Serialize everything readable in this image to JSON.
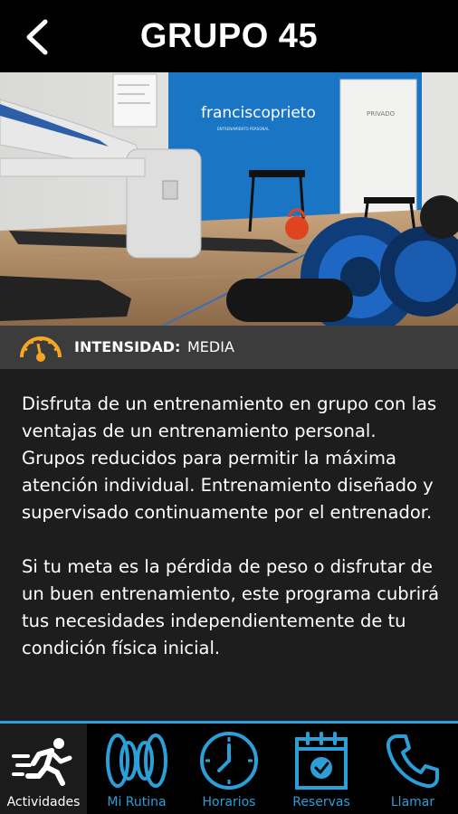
{
  "header": {
    "title": "GRUPO 45",
    "back_icon": "chevron-left-icon"
  },
  "hero": {
    "wall_brand": "franciscoprieto",
    "wall_sub": "ENTRENAMIENTO PERSONAL",
    "door_sign": "PRIVADO"
  },
  "intensity": {
    "icon": "gauge-icon",
    "label": "INTENSIDAD:",
    "value": "MEDIA"
  },
  "description": {
    "paragraph1": "Disfruta de un entrenamiento en grupo con las ventajas de un entrenamiento personal. Grupos reducidos para permitir la máxima atención individual. Entrenamiento diseñado y supervisado continuamente por el entrenador.",
    "paragraph2": "Si tu meta es la pérdida de peso o disfrutar de un buen entrenamiento, este programa cubrirá tus necesidades independientemente de tu condición física inicial."
  },
  "tabs": [
    {
      "label": "Actividades",
      "icon": "runner-icon",
      "active": true
    },
    {
      "label": "Mi Rutina",
      "icon": "weights-icon",
      "active": false
    },
    {
      "label": "Horarios",
      "icon": "clock-icon",
      "active": false
    },
    {
      "label": "Reservas",
      "icon": "calendar-check-icon",
      "active": false
    },
    {
      "label": "Llamar",
      "icon": "phone-icon",
      "active": false
    }
  ],
  "colors": {
    "accent": "#2a9fd8",
    "gauge": "#f5a623",
    "header_bg": "#000000",
    "body_bg": "#1d1d1d"
  }
}
